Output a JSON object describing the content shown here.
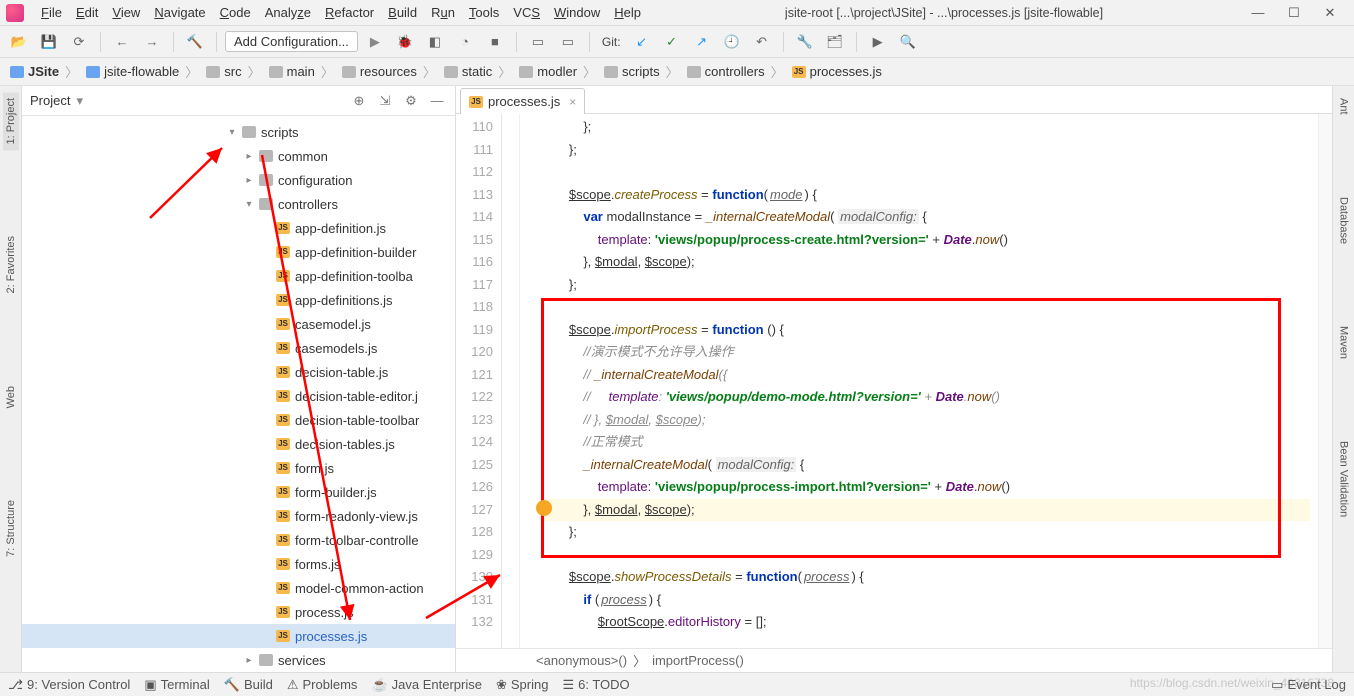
{
  "menubar": {
    "items": [
      "File",
      "Edit",
      "View",
      "Navigate",
      "Code",
      "Analyze",
      "Refactor",
      "Build",
      "Run",
      "Tools",
      "VCS",
      "Window",
      "Help"
    ],
    "title": "jsite-root [...\\project\\JSite] - ...\\processes.js [jsite-flowable]"
  },
  "toolbar": {
    "add_config": "Add Configuration...",
    "git_label": "Git:"
  },
  "breadcrumb": {
    "parts": [
      "JSite",
      "jsite-flowable",
      "src",
      "main",
      "resources",
      "static",
      "modler",
      "scripts",
      "controllers",
      "processes.js"
    ]
  },
  "project_panel": {
    "title": "Project"
  },
  "left_tabs": [
    "1: Project",
    "2: Favorites",
    "Web",
    "7: Structure"
  ],
  "right_tabs": [
    "Ant",
    "Database",
    "Maven",
    "Bean Validation"
  ],
  "tree": [
    {
      "indent": 0,
      "type": "folder",
      "label": "scripts",
      "expanded": true
    },
    {
      "indent": 1,
      "type": "folder",
      "label": "common",
      "expanded": false,
      "has_arrow": true
    },
    {
      "indent": 1,
      "type": "folder",
      "label": "configuration",
      "expanded": false,
      "has_arrow": true
    },
    {
      "indent": 1,
      "type": "folder",
      "label": "controllers",
      "expanded": true
    },
    {
      "indent": 2,
      "type": "js",
      "label": "app-definition.js"
    },
    {
      "indent": 2,
      "type": "js",
      "label": "app-definition-builder"
    },
    {
      "indent": 2,
      "type": "js",
      "label": "app-definition-toolba"
    },
    {
      "indent": 2,
      "type": "js",
      "label": "app-definitions.js"
    },
    {
      "indent": 2,
      "type": "js",
      "label": "casemodel.js"
    },
    {
      "indent": 2,
      "type": "js",
      "label": "casemodels.js"
    },
    {
      "indent": 2,
      "type": "js",
      "label": "decision-table.js"
    },
    {
      "indent": 2,
      "type": "js",
      "label": "decision-table-editor.j"
    },
    {
      "indent": 2,
      "type": "js",
      "label": "decision-table-toolbar"
    },
    {
      "indent": 2,
      "type": "js",
      "label": "decision-tables.js"
    },
    {
      "indent": 2,
      "type": "js",
      "label": "form.js"
    },
    {
      "indent": 2,
      "type": "js",
      "label": "form-builder.js"
    },
    {
      "indent": 2,
      "type": "js",
      "label": "form-readonly-view.js"
    },
    {
      "indent": 2,
      "type": "js",
      "label": "form-toolbar-controlle"
    },
    {
      "indent": 2,
      "type": "js",
      "label": "forms.js"
    },
    {
      "indent": 2,
      "type": "js",
      "label": "model-common-action"
    },
    {
      "indent": 2,
      "type": "js",
      "label": "process.js"
    },
    {
      "indent": 2,
      "type": "js",
      "label": "processes.js",
      "selected": true
    },
    {
      "indent": 1,
      "type": "folder",
      "label": "services",
      "expanded": false,
      "has_arrow": true
    }
  ],
  "editor": {
    "tab": "processes.js",
    "first_line": 110,
    "lines": [
      "            };",
      "        };",
      "",
      "        $scope.createProcess = function(mode) {",
      "            var modalInstance = _internalCreateModal( modalConfig: {",
      "                template: 'views/popup/process-create.html?version=' + Date.now()",
      "            }, $modal, $scope);",
      "        };",
      "",
      "        $scope.importProcess = function () {",
      "            //演示模式不允许导入操作",
      "            // _internalCreateModal({",
      "            //     template: 'views/popup/demo-mode.html?version=' + Date.now()",
      "            // }, $modal, $scope);",
      "            //正常模式",
      "            _internalCreateModal( modalConfig: {",
      "                template: 'views/popup/process-import.html?version=' + Date.now()",
      "            }, $modal, $scope);",
      "        };",
      "",
      "        $scope.showProcessDetails = function(process) {",
      "            if (process) {",
      "                $rootScope.editorHistory = [];"
    ],
    "breadcrumb": [
      "<anonymous>()",
      "importProcess()"
    ]
  },
  "statusbar": {
    "items": [
      "9: Version Control",
      "Terminal",
      "Build",
      "Problems",
      "Java Enterprise",
      "Spring",
      "6: TODO"
    ],
    "event_log": "Event Log"
  },
  "watermark": "https://blog.csdn.net/weixin_40816738"
}
